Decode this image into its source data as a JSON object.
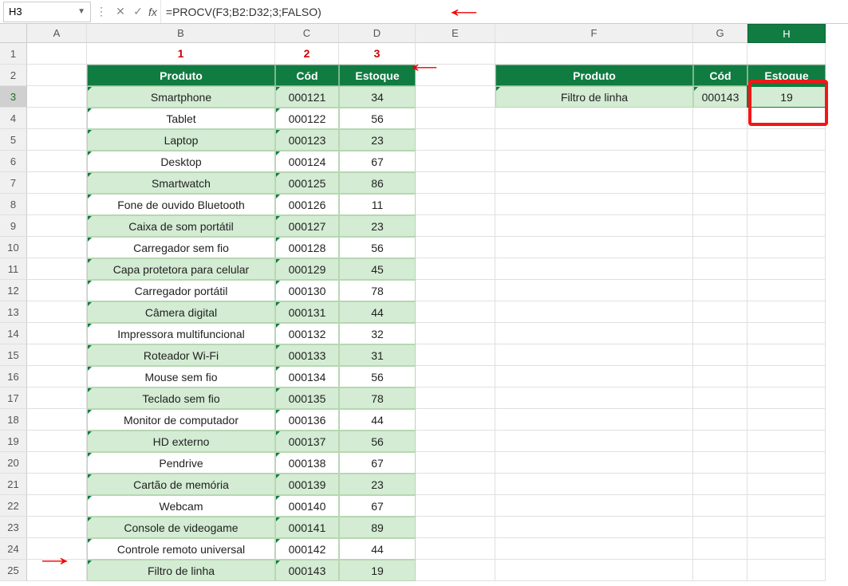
{
  "nameBox": "H3",
  "formula": "=PROCV(F3;B2:D32;3;FALSO)",
  "cols": [
    "A",
    "B",
    "C",
    "D",
    "E",
    "F",
    "G",
    "H"
  ],
  "annotations": {
    "a1": "1",
    "a2": "2",
    "a3": "3"
  },
  "table1": {
    "headers": {
      "produto": "Produto",
      "cod": "Cód",
      "estoque": "Estoque"
    },
    "rows": [
      {
        "p": "Smartphone",
        "c": "000121",
        "e": "34"
      },
      {
        "p": "Tablet",
        "c": "000122",
        "e": "56"
      },
      {
        "p": "Laptop",
        "c": "000123",
        "e": "23"
      },
      {
        "p": "Desktop",
        "c": "000124",
        "e": "67"
      },
      {
        "p": "Smartwatch",
        "c": "000125",
        "e": "86"
      },
      {
        "p": "Fone de ouvido Bluetooth",
        "c": "000126",
        "e": "11"
      },
      {
        "p": "Caixa de som portátil",
        "c": "000127",
        "e": "23"
      },
      {
        "p": "Carregador sem fio",
        "c": "000128",
        "e": "56"
      },
      {
        "p": "Capa protetora para celular",
        "c": "000129",
        "e": "45"
      },
      {
        "p": "Carregador portátil",
        "c": "000130",
        "e": "78"
      },
      {
        "p": "Câmera digital",
        "c": "000131",
        "e": "44"
      },
      {
        "p": "Impressora multifuncional",
        "c": "000132",
        "e": "32"
      },
      {
        "p": "Roteador Wi-Fi",
        "c": "000133",
        "e": "31"
      },
      {
        "p": "Mouse sem fio",
        "c": "000134",
        "e": "56"
      },
      {
        "p": "Teclado sem fio",
        "c": "000135",
        "e": "78"
      },
      {
        "p": "Monitor de computador",
        "c": "000136",
        "e": "44"
      },
      {
        "p": "HD externo",
        "c": "000137",
        "e": "56"
      },
      {
        "p": "Pendrive",
        "c": "000138",
        "e": "67"
      },
      {
        "p": "Cartão de memória",
        "c": "000139",
        "e": "23"
      },
      {
        "p": "Webcam",
        "c": "000140",
        "e": "67"
      },
      {
        "p": "Console de videogame",
        "c": "000141",
        "e": "89"
      },
      {
        "p": "Controle remoto universal",
        "c": "000142",
        "e": "44"
      },
      {
        "p": "Filtro de linha",
        "c": "000143",
        "e": "19"
      }
    ]
  },
  "table2": {
    "headers": {
      "produto": "Produto",
      "cod": "Cód",
      "estoque": "Estoque"
    },
    "result": {
      "p": "Filtro de linha",
      "c": "000143",
      "e": "19"
    }
  }
}
